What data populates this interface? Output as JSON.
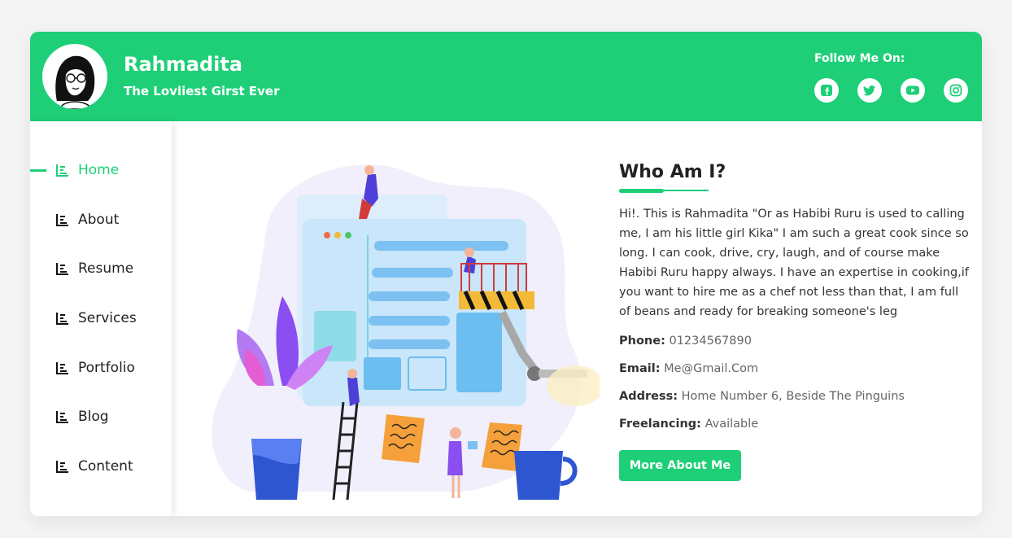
{
  "header": {
    "name": "Rahmadita",
    "tagline": "The Lovliest Girst Ever",
    "follow_label": "Follow Me On:",
    "socials": [
      "facebook-icon",
      "twitter-icon",
      "youtube-icon",
      "instagram-icon"
    ]
  },
  "sidebar": {
    "items": [
      {
        "label": "Home",
        "active": true
      },
      {
        "label": "About"
      },
      {
        "label": "Resume"
      },
      {
        "label": "Services"
      },
      {
        "label": "Portfolio"
      },
      {
        "label": "Blog"
      },
      {
        "label": "Content"
      }
    ]
  },
  "about": {
    "heading": "Who Am I?",
    "bio": "Hi!. This is Rahmadita \"Or as Habibi Ruru is used to calling me, I am his little girl Kika\" I am such a great cook since so long. I can cook, drive, cry, laugh, and of course make Habibi Ruru happy always. I have an expertise in cooking,if you want to hire me as a chef not less than that, I am full of beans and ready for breaking someone's leg",
    "phone_label": "Phone:",
    "phone": "01234567890",
    "email_label": "Email:",
    "email": "Me@Gmail.Com",
    "address_label": "Address:",
    "address": "Home Number 6, Beside The Pinguins",
    "freelancing_label": "Freelancing:",
    "freelancing": "Available",
    "button_label": "More About Me"
  },
  "colors": {
    "accent": "#1ecf78",
    "text": "#222222",
    "muted": "#666666"
  }
}
